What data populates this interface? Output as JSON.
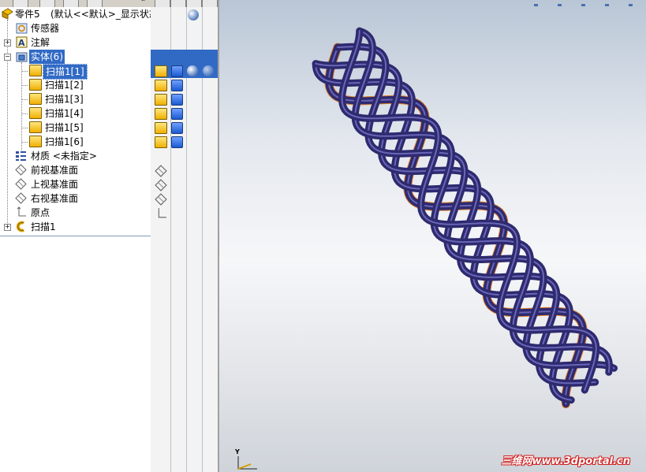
{
  "feature_tree": {
    "root_label": "零件5",
    "root_config": "(默认<<默认>_显示状态",
    "items": [
      {
        "label": "传感器",
        "icon": "sensor-folder-icon"
      },
      {
        "label": "注解",
        "icon": "annotation-icon"
      },
      {
        "label": "实体(6)",
        "icon": "solid-bodies-folder-icon"
      },
      {
        "label": "扫描1[1]",
        "icon": "body-icon"
      },
      {
        "label": "扫描1[2]",
        "icon": "body-icon"
      },
      {
        "label": "扫描1[3]",
        "icon": "body-icon"
      },
      {
        "label": "扫描1[4]",
        "icon": "body-icon"
      },
      {
        "label": "扫描1[5]",
        "icon": "body-icon"
      },
      {
        "label": "扫描1[6]",
        "icon": "body-icon"
      },
      {
        "label": "材质 <未指定>",
        "icon": "material-icon"
      },
      {
        "label": "前视基准面",
        "icon": "plane-icon"
      },
      {
        "label": "上视基准面",
        "icon": "plane-icon"
      },
      {
        "label": "右视基准面",
        "icon": "plane-icon"
      },
      {
        "label": "原点",
        "icon": "origin-icon"
      },
      {
        "label": "扫描1",
        "icon": "sweep-feature-icon"
      }
    ]
  },
  "viewport": {
    "watermark": "三维网www.3dportal.cn",
    "triad_axis": "Y",
    "model_color": "#2e2a6e",
    "highlight_color": "#e07818"
  },
  "colors": {
    "selection": "#316ac5",
    "panel_bg": "#ffffff",
    "column_bg": "#f3f3f3"
  }
}
